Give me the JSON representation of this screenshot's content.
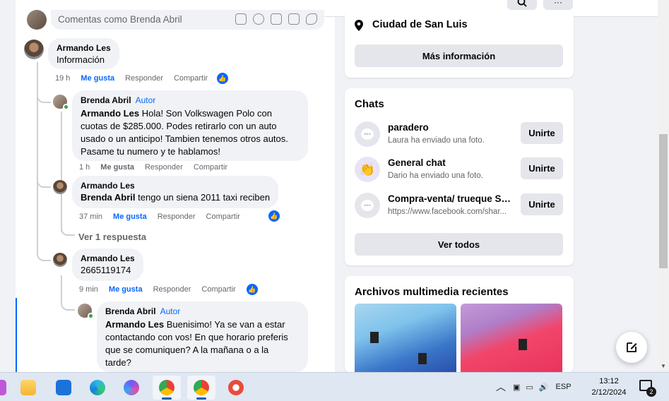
{
  "composer": {
    "placeholder": "Comentas como Brenda Abril"
  },
  "comments": [
    {
      "author": "Armando Les",
      "text": "Información",
      "time": "19 h",
      "like": "Me gusta",
      "reply": "Responder",
      "share": "Compartir"
    },
    {
      "author": "Brenda Abril",
      "badge": "Autor",
      "mention": "Armando Les",
      "text_lines": [
        "Hola! Son Volkswagen Polo con",
        "cuotas de $285.000. Podes retirarlo con un auto",
        "usado o un anticipo! Tambien tenemos otros autos.",
        "Pasame tu numero y te hablamos!"
      ],
      "time": "1 h",
      "like": "Me gusta",
      "reply": "Responder",
      "share": "Compartir"
    },
    {
      "author": "Armando Les",
      "mention": "Brenda Abril",
      "text": "tengo un siena 2011 taxi reciben",
      "time": "37 min",
      "like": "Me gusta",
      "reply": "Responder",
      "share": "Compartir"
    },
    {
      "author": "Armando Les",
      "text": "2665119174",
      "time": "9 min",
      "like": "Me gusta",
      "reply": "Responder",
      "share": "Compartir"
    },
    {
      "author": "Brenda Abril",
      "badge": "Autor",
      "mention": "Armando Les",
      "text_lines": [
        "Buenisimo! Ya se van a estar",
        "contactando con vos! En que horario preferis",
        "que se comuniquen? A la mañana o a la",
        "tarde?"
      ]
    }
  ],
  "view_replies": "Ver 1 respuesta",
  "sidebar": {
    "location": "Ciudad de San Luis",
    "more_info": "Más información",
    "chats_title": "Chats",
    "chats": [
      {
        "name": "paradero",
        "sub": "Laura ha enviado una foto.",
        "join": "Unirte",
        "icon": "chat-bubble-icon"
      },
      {
        "name": "General chat",
        "sub": "Dario ha enviado una foto.",
        "join": "Unirte",
        "icon": "clapping-hands-icon"
      },
      {
        "name": "Compra-venta/ trueque Sa...",
        "sub": "https://www.facebook.com/shar...",
        "join": "Unirte",
        "icon": "chat-bubble-icon"
      }
    ],
    "see_all": "Ver todos",
    "media_title": "Archivos multimedia recientes"
  },
  "taskbar": {
    "language": "ESP",
    "time": "13:12",
    "date": "2/12/2024",
    "notifications": "2"
  },
  "colors": {
    "accent": "#0866ff",
    "bubble": "#f0f2f5",
    "secondary_button": "#e4e6eb"
  }
}
